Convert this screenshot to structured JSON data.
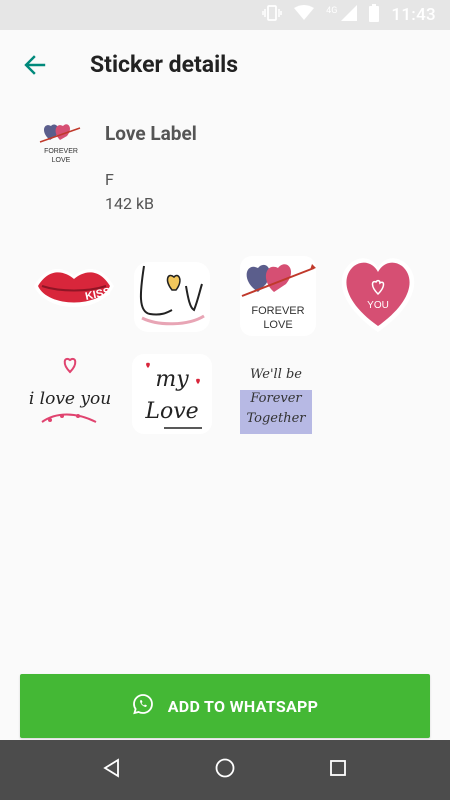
{
  "status_bar": {
    "time": "11:43",
    "network": "4G"
  },
  "toolbar": {
    "title": "Sticker details"
  },
  "pack": {
    "name": "Love Label",
    "author": "F",
    "size": "142 kB"
  },
  "stickers": [
    {
      "icon": "kiss-lips-sticker",
      "text": "KISS"
    },
    {
      "icon": "love-heart-lettering-sticker",
      "text": "Love"
    },
    {
      "icon": "forever-love-hearts-sticker",
      "text": "FOREVER LOVE"
    },
    {
      "icon": "heart-you-sticker",
      "text": "YOU"
    },
    {
      "icon": "i-love-you-sticker",
      "text": "i love you"
    },
    {
      "icon": "my-love-sticker",
      "text": "my Love"
    },
    {
      "icon": "forever-together-sticker",
      "text": "We'll be Forever Together"
    }
  ],
  "actions": {
    "add_label": "ADD TO WHATSAPP"
  },
  "colors": {
    "accent": "#44b835",
    "back_arrow": "#00897b",
    "nav_bar": "#4c4c4c"
  }
}
